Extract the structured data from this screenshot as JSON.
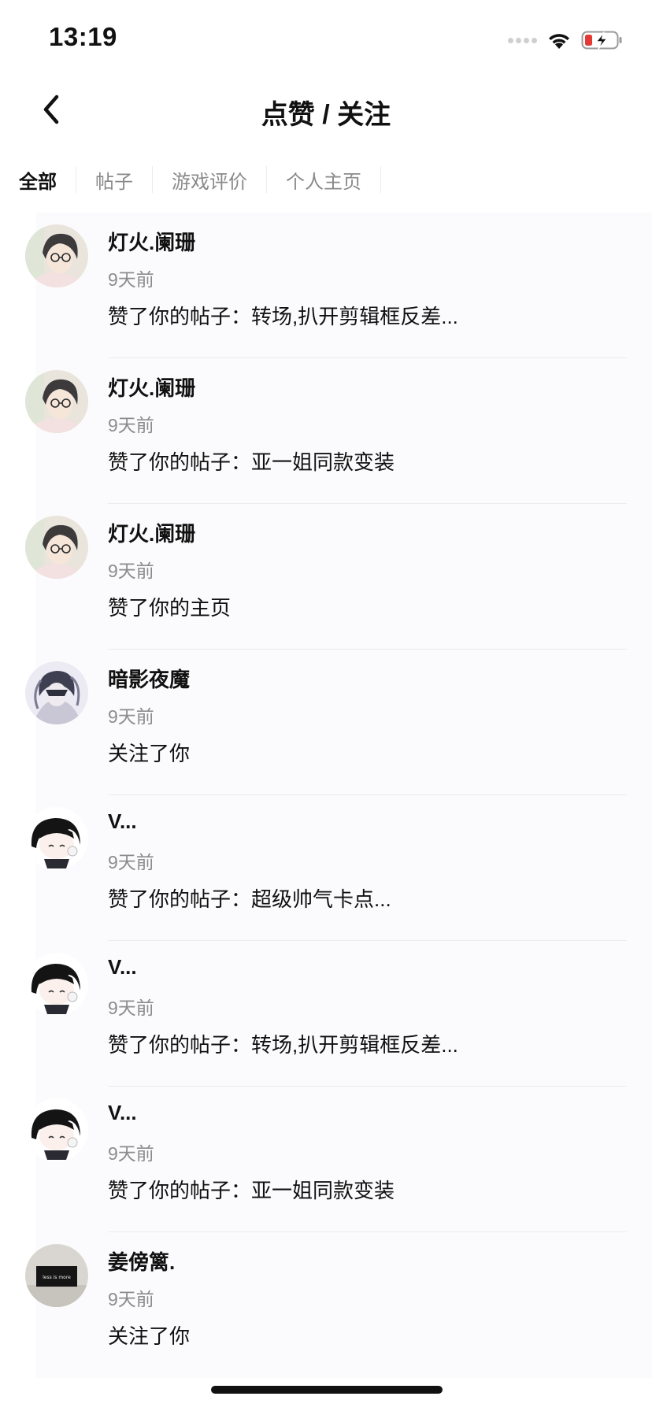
{
  "status_bar": {
    "time": "13:19",
    "icons": [
      "signal-dots-icon",
      "wifi-icon",
      "battery-charging-icon"
    ],
    "battery_color": "#e53935"
  },
  "nav": {
    "back_icon": "chevron-left-icon",
    "title": "点赞 / 关注"
  },
  "tabs": [
    {
      "label": "全部",
      "active": true
    },
    {
      "label": "帖子",
      "active": false
    },
    {
      "label": "游戏评价",
      "active": false
    },
    {
      "label": "个人主页",
      "active": false
    }
  ],
  "feed": [
    {
      "name": "灯火.阑珊",
      "time": "9天前",
      "action": "赞了你的帖子：转场,扒开剪辑框反差...",
      "avatar": "anime-boy-glasses-avatar"
    },
    {
      "name": "灯火.阑珊",
      "time": "9天前",
      "action": "赞了你的帖子：亚一姐同款变装",
      "avatar": "anime-boy-glasses-avatar"
    },
    {
      "name": "灯火.阑珊",
      "time": "9天前",
      "action": "赞了你的主页",
      "avatar": "anime-boy-glasses-avatar"
    },
    {
      "name": "暗影夜魔",
      "time": "9天前",
      "action": "关注了你",
      "avatar": "dark-anime-character-avatar"
    },
    {
      "name": "V...",
      "time": "9天前",
      "action": "赞了你的帖子：超级帅气卡点...",
      "avatar": "chibi-black-hair-avatar"
    },
    {
      "name": "V...",
      "time": "9天前",
      "action": "赞了你的帖子：转场,扒开剪辑框反差...",
      "avatar": "chibi-black-hair-avatar"
    },
    {
      "name": "V...",
      "time": "9天前",
      "action": "赞了你的帖子：亚一姐同款变装",
      "avatar": "chibi-black-hair-avatar"
    },
    {
      "name": "姜傍篱.",
      "time": "9天前",
      "action": "关注了你",
      "avatar": "black-sign-photo-avatar",
      "avatar_text": "less is more"
    }
  ],
  "colors": {
    "text_primary": "#111111",
    "text_secondary": "#8c8c8c",
    "divider": "#ebebeb",
    "row_background": "#fbfbfd"
  }
}
